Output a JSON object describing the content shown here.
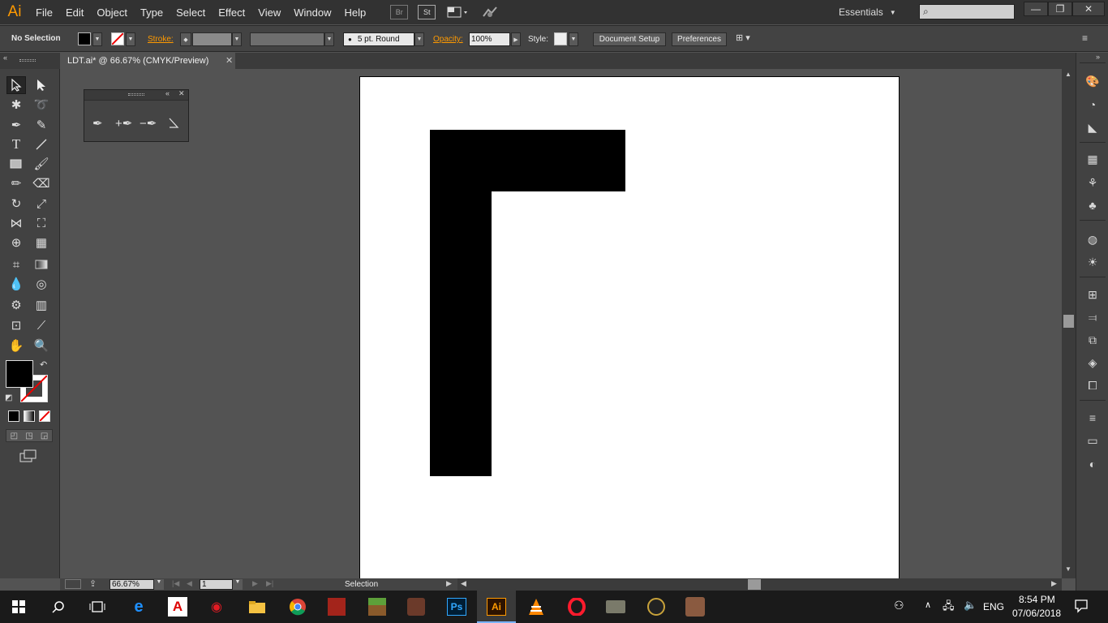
{
  "app": {
    "logo": "Ai",
    "accent": "#ff9a00"
  },
  "menu": [
    "File",
    "Edit",
    "Object",
    "Type",
    "Select",
    "Effect",
    "View",
    "Window",
    "Help"
  ],
  "menu_icons": {
    "bridge": "Br",
    "stock": "St"
  },
  "workspace": {
    "label": "Essentials"
  },
  "window_controls": {
    "minimize": "—",
    "restore": "❐",
    "close": "✕"
  },
  "control_bar": {
    "selection_status": "No Selection",
    "stroke_label": "Stroke:",
    "brush_label": "5 pt. Round",
    "opacity_label": "Opacity:",
    "opacity_value": "100%",
    "style_label": "Style:",
    "document_setup": "Document Setup",
    "preferences": "Preferences"
  },
  "document": {
    "tab_title": "LDT.ai* @ 66.67% (CMYK/Preview)"
  },
  "canvas": {
    "shape_color": "#000000",
    "artboard_color": "#ffffff"
  },
  "status_bar": {
    "zoom": "66.67%",
    "artboard_number": "1",
    "status_text": "Selection"
  },
  "taskbar": {
    "time": "8:54 PM",
    "date": "07/06/2018",
    "language": "ENG",
    "apps": [
      "ps-icon",
      "ai-icon"
    ],
    "ps_label": "Ps",
    "ai_label": "Ai"
  }
}
